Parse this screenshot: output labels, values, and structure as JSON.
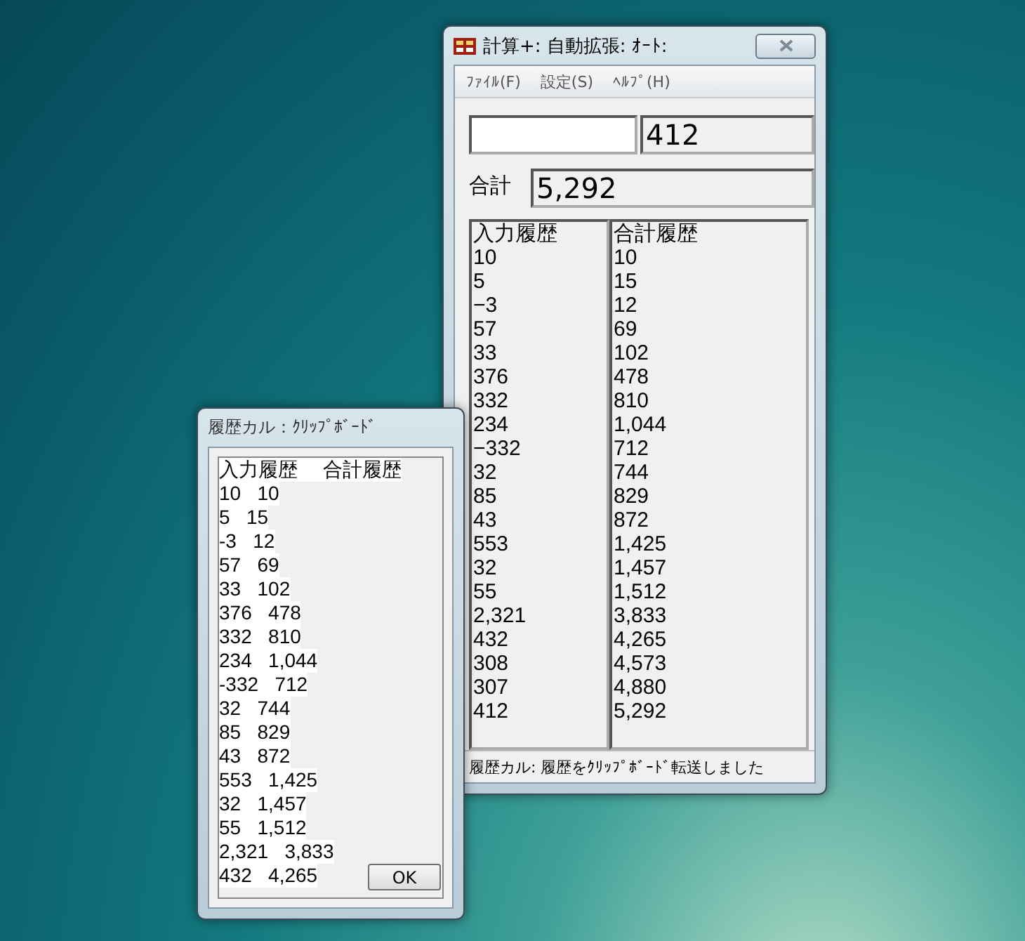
{
  "main_window": {
    "title": "計算+: 自動拡張: ｵｰﾄ:",
    "menu": [
      "ﾌｧｲﾙ(F)",
      "設定(S)",
      "ﾍﾙﾌﾟ(H)"
    ],
    "last_input": "412",
    "total_label": "合計",
    "total": "5,292",
    "input_history": {
      "header": "入力履歴",
      "items": [
        "10",
        "5",
        "−3",
        "57",
        "33",
        "376",
        "332",
        "234",
        "−332",
        "32",
        "85",
        "43",
        "553",
        "32",
        "55",
        "2,321",
        "432",
        "308",
        "307",
        "412"
      ]
    },
    "total_history": {
      "header": "合計履歴",
      "items": [
        "10",
        "15",
        "12",
        "69",
        "102",
        "478",
        "810",
        "1,044",
        "712",
        "744",
        "829",
        "872",
        "1,425",
        "1,457",
        "1,512",
        "3,833",
        "4,265",
        "4,573",
        "4,880",
        "5,292"
      ]
    },
    "status_bar": "履歴カル: 履歴をｸﾘｯﾌﾟﾎﾞｰﾄﾞ転送しました"
  },
  "dialog": {
    "title": "履歴カル：ｸﾘｯﾌﾟﾎﾞｰﾄﾞ",
    "header": [
      "入力履歴",
      "合計履歴"
    ],
    "rows": [
      [
        "10",
        "10"
      ],
      [
        "5",
        "15"
      ],
      [
        "-3",
        "12"
      ],
      [
        "57",
        "69"
      ],
      [
        "33",
        "102"
      ],
      [
        "376",
        "478"
      ],
      [
        "332",
        "810"
      ],
      [
        "234",
        "1,044"
      ],
      [
        "-332",
        "712"
      ],
      [
        "32",
        "744"
      ],
      [
        "85",
        "829"
      ],
      [
        "43",
        "872"
      ],
      [
        "553",
        "1,425"
      ],
      [
        "32",
        "1,457"
      ],
      [
        "55",
        "1,512"
      ],
      [
        "2,321",
        "3,833"
      ],
      [
        "432",
        "4,265"
      ]
    ],
    "ok_button": "OK"
  }
}
